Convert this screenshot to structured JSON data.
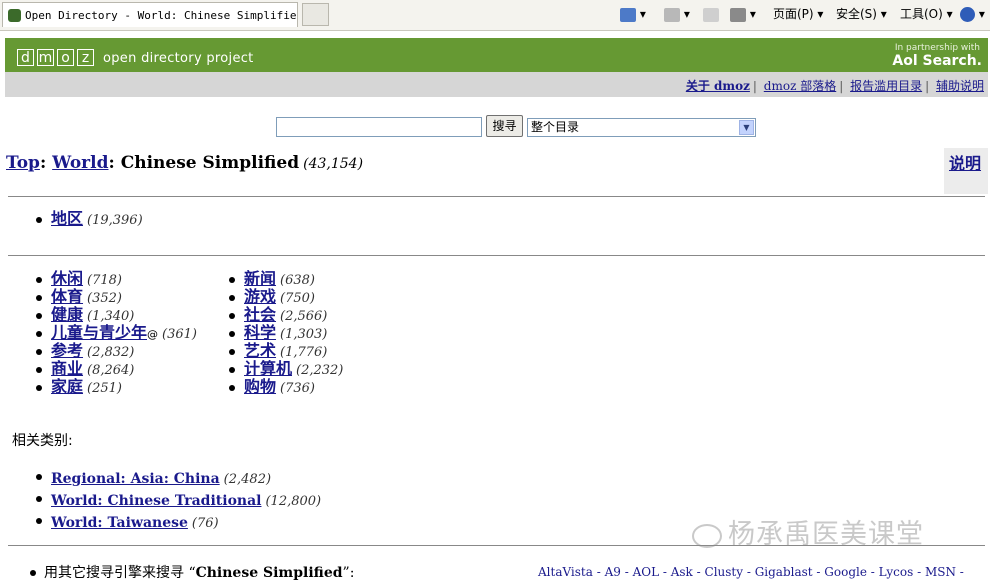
{
  "browser": {
    "tab_title": "Open Directory - World: Chinese Simplified",
    "toolbar": {
      "page": "页面(P)",
      "safety": "安全(S)",
      "tools": "工具(O)"
    }
  },
  "header": {
    "logo_letters": [
      "d",
      "m",
      "o",
      "z"
    ],
    "site_name": "open directory project",
    "partner_line": "In partnership with",
    "partner_brand": "Aol Search."
  },
  "topnav": [
    "关于 dmoz",
    "dmoz 部落格",
    "报告滥用目录",
    "辅助说明"
  ],
  "search": {
    "query": "",
    "button": "搜寻",
    "scope": "整个目录"
  },
  "breadcrumb": {
    "top": "Top",
    "world": "World",
    "current": "Chinese Simplified",
    "count": "(43,154)"
  },
  "help_link": "说明",
  "region": {
    "label": "地区",
    "count": "(19,396)"
  },
  "categories_left": [
    {
      "label": "休闲",
      "count": "(718)"
    },
    {
      "label": "体育",
      "count": "(352)"
    },
    {
      "label": "健康",
      "count": "(1,340)"
    },
    {
      "label": "儿童与青少年",
      "at": "@",
      "count": "(361)"
    },
    {
      "label": "参考",
      "count": "(2,832)"
    },
    {
      "label": "商业",
      "count": "(8,264)"
    },
    {
      "label": "家庭",
      "count": "(251)"
    }
  ],
  "categories_right": [
    {
      "label": "新闻",
      "count": "(638)"
    },
    {
      "label": "游戏",
      "count": "(750)"
    },
    {
      "label": "社会",
      "count": "(2,566)"
    },
    {
      "label": "科学",
      "count": "(1,303)"
    },
    {
      "label": "艺术",
      "count": "(1,776)"
    },
    {
      "label": "计算机",
      "count": "(2,232)"
    },
    {
      "label": "购物",
      "count": "(736)"
    }
  ],
  "related_heading": "相关类别:",
  "related": [
    {
      "label": "Regional: Asia: China",
      "count": "(2,482)"
    },
    {
      "label": "World: Chinese Traditional",
      "count": "(12,800)"
    },
    {
      "label": "World: Taiwanese",
      "count": "(76)"
    }
  ],
  "watermark": "杨承禹医美课堂",
  "bottom": {
    "prefix": "用其它搜寻引擎来搜寻 “",
    "term": "Chinese Simplified",
    "suffix": "”:"
  },
  "engines": "AltaVista - A9 - AOL - Ask - Clusty - Gigablast - Google - Lycos - MSN -"
}
